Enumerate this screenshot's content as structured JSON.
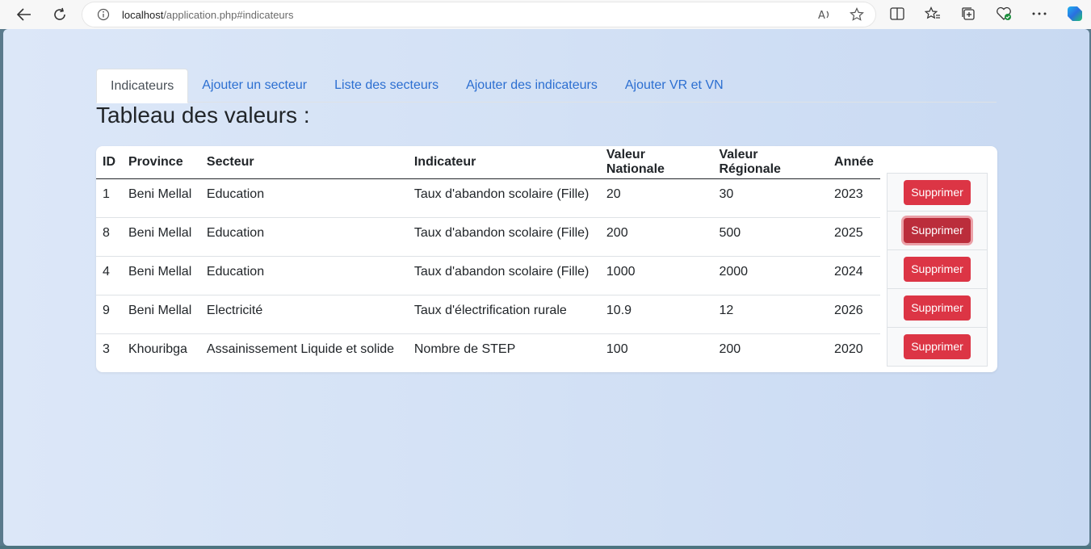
{
  "browser": {
    "url_host": "localhost",
    "url_path": "/application.php#indicateurs"
  },
  "tabs": [
    {
      "label": "Indicateurs",
      "active": true
    },
    {
      "label": "Ajouter un secteur",
      "active": false
    },
    {
      "label": "Liste des secteurs",
      "active": false
    },
    {
      "label": "Ajouter des indicateurs",
      "active": false
    },
    {
      "label": "Ajouter VR et VN",
      "active": false
    }
  ],
  "page": {
    "title": "Tableau des valeurs :"
  },
  "table": {
    "headers": [
      "ID",
      "Province",
      "Secteur",
      "Indicateur",
      "Valeur Nationale",
      "Valeur Régionale",
      "Année"
    ],
    "rows": [
      [
        "1",
        "Beni Mellal",
        "Education",
        "Taux d'abandon scolaire (Fille)",
        "20",
        "30",
        "2023"
      ],
      [
        "8",
        "Beni Mellal",
        "Education",
        "Taux d'abandon scolaire (Fille)",
        "200",
        "500",
        "2025"
      ],
      [
        "4",
        "Beni Mellal",
        "Education",
        "Taux d'abandon scolaire (Fille)",
        "1000",
        "2000",
        "2024"
      ],
      [
        "9",
        "Beni Mellal",
        "Electricité",
        "Taux d'électrification rurale",
        "10.9",
        "12",
        "2026"
      ],
      [
        "3",
        "Khouribga",
        "Assainissement Liquide et solide",
        "Nombre de STEP",
        "100",
        "200",
        "2020"
      ]
    ],
    "action_label": "Supprimer"
  },
  "colors": {
    "danger": "#dc3545",
    "link": "#2c6fd1"
  }
}
